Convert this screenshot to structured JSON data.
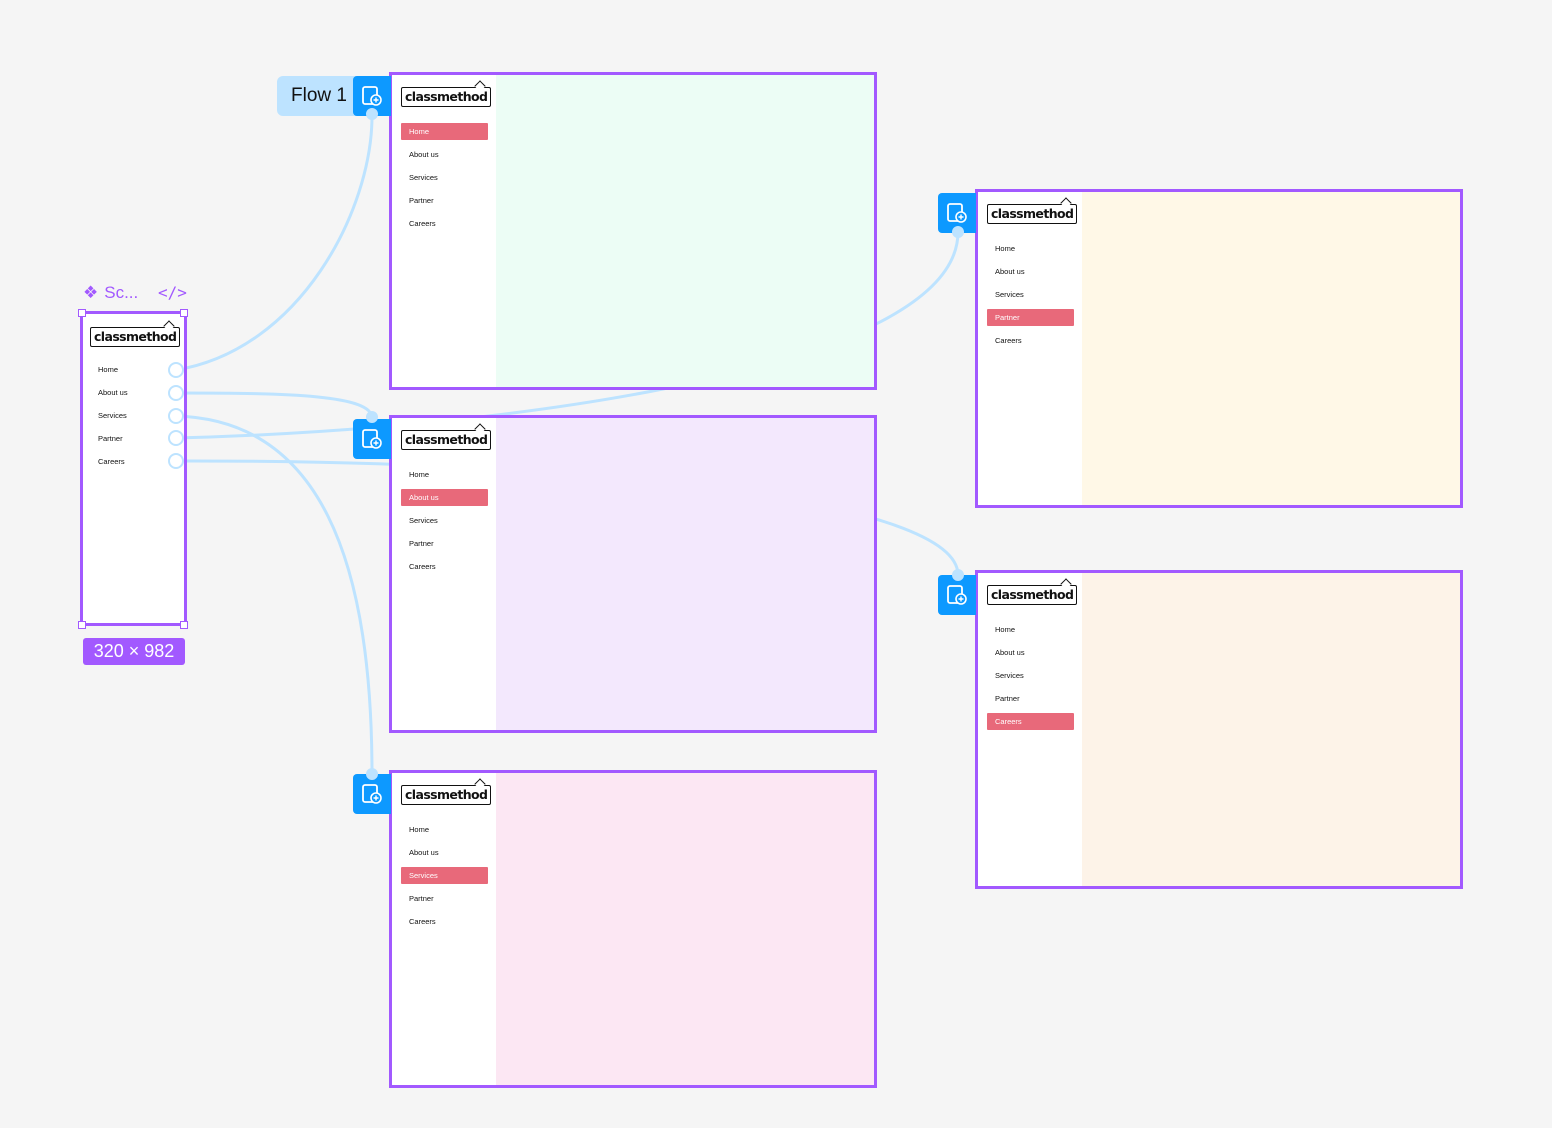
{
  "canvas": {
    "background": "#f5f5f5",
    "selection_color": "#a259ff",
    "connector_color": "#bde3ff",
    "flow_icon_color": "#0d99ff",
    "active_item_color": "#e8697a"
  },
  "flow": {
    "label": "Flow 1",
    "icon": "prototype-start-icon"
  },
  "component": {
    "name": "Sc...",
    "code_label": "</>",
    "size_label": "320 × 982",
    "logo": "classmethod",
    "nav": [
      "Home",
      "About us",
      "Services",
      "Partner",
      "Careers"
    ]
  },
  "screens": [
    {
      "id": "home",
      "logo": "classmethod",
      "bg": "#ecfdf5",
      "nav": [
        "Home",
        "About us",
        "Services",
        "Partner",
        "Careers"
      ],
      "active": 0
    },
    {
      "id": "about",
      "logo": "classmethod",
      "bg": "#f3e8fd",
      "nav": [
        "Home",
        "About us",
        "Services",
        "Partner",
        "Careers"
      ],
      "active": 1
    },
    {
      "id": "services",
      "logo": "classmethod",
      "bg": "#fce7f3",
      "nav": [
        "Home",
        "About us",
        "Services",
        "Partner",
        "Careers"
      ],
      "active": 2
    },
    {
      "id": "partner",
      "logo": "classmethod",
      "bg": "#fff8e7",
      "nav": [
        "Home",
        "About us",
        "Services",
        "Partner",
        "Careers"
      ],
      "active": 3
    },
    {
      "id": "careers",
      "logo": "classmethod",
      "bg": "#fdf3e8",
      "nav": [
        "Home",
        "About us",
        "Services",
        "Partner",
        "Careers"
      ],
      "active": 4
    }
  ]
}
